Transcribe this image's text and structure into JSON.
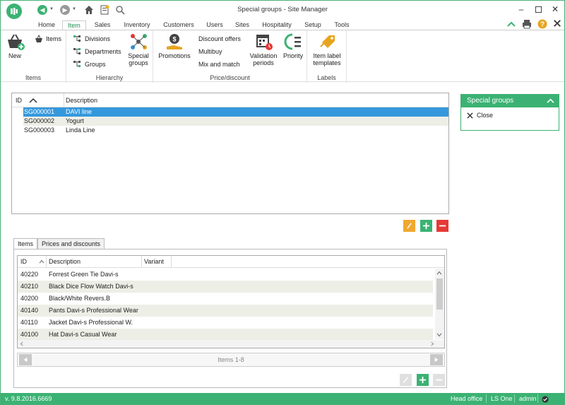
{
  "window": {
    "title": "Special groups - Site Manager"
  },
  "tabs": [
    "Home",
    "Item",
    "Sales",
    "Inventory",
    "Customers",
    "Users",
    "Sites",
    "Hospitality",
    "Setup",
    "Tools"
  ],
  "active_tab": "Item",
  "ribbon": {
    "items_group": {
      "label": "Items",
      "new_label": "New",
      "items_label": "Items"
    },
    "hierarchy_group": {
      "label": "Hierarchy",
      "divisions": "Divisions",
      "departments": "Departments",
      "groups": "Groups",
      "special_groups_line1": "Special",
      "special_groups_line2": "groups"
    },
    "price_group": {
      "label": "Price/discount",
      "promotions": "Promotions",
      "discount_offers": "Discount offers",
      "multibuy": "Multibuy",
      "mix_and_match": "Mix and match",
      "validation_line1": "Validation",
      "validation_line2": "periods",
      "priority": "Priority"
    },
    "labels_group": {
      "label": "Labels",
      "item_label_line1": "Item label",
      "item_label_line2": "templates"
    }
  },
  "groups_grid": {
    "col_id": "ID",
    "col_description": "Description",
    "rows": [
      {
        "id": "SG000001",
        "description": "DAVI line"
      },
      {
        "id": "SG000002",
        "description": "Yogurt"
      },
      {
        "id": "SG000003",
        "description": "Linda Line"
      }
    ]
  },
  "side_panel": {
    "title": "Special groups",
    "close_label": "Close"
  },
  "bottom_tabs": [
    "Items",
    "Prices and discounts"
  ],
  "items_grid": {
    "col_id": "ID",
    "col_description": "Description",
    "col_variant": "Variant",
    "rows": [
      {
        "id": "40220",
        "description": "Forrest Green Tie Davi-s",
        "variant": ""
      },
      {
        "id": "40210",
        "description": "Black Dice Flow Watch Davi-s",
        "variant": ""
      },
      {
        "id": "40200",
        "description": "Black/White Revers.B",
        "variant": ""
      },
      {
        "id": "40140",
        "description": "Pants Davi-s Professional Wear",
        "variant": ""
      },
      {
        "id": "40110",
        "description": "Jacket Davi-s Professional W.",
        "variant": ""
      },
      {
        "id": "40100",
        "description": "Hat Davi-s Casual Wear",
        "variant": ""
      }
    ],
    "pager_text": "Items 1-8"
  },
  "statusbar": {
    "version": "v. 9.8.2016.6669",
    "store": "Head office",
    "product": "LS One",
    "user": "admin"
  },
  "colors": {
    "brand_green": "#3bb273",
    "selection_blue": "#3598dc",
    "edit_orange": "#f0a830",
    "add_green": "#3bb273",
    "remove_red": "#e53935"
  }
}
